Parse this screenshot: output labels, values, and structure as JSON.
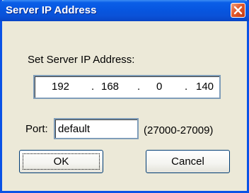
{
  "window": {
    "title": "Server IP Address",
    "close_icon": "close-icon",
    "accent_color": "#0a52e6",
    "close_color": "#e2592c"
  },
  "ip": {
    "label": "Set Server IP Address:",
    "octets": [
      "192",
      "168",
      "0",
      "140"
    ],
    "separator": "."
  },
  "port": {
    "label": "Port:",
    "value": "default",
    "range": "(27000-27009)"
  },
  "buttons": {
    "ok": "OK",
    "cancel": "Cancel"
  }
}
